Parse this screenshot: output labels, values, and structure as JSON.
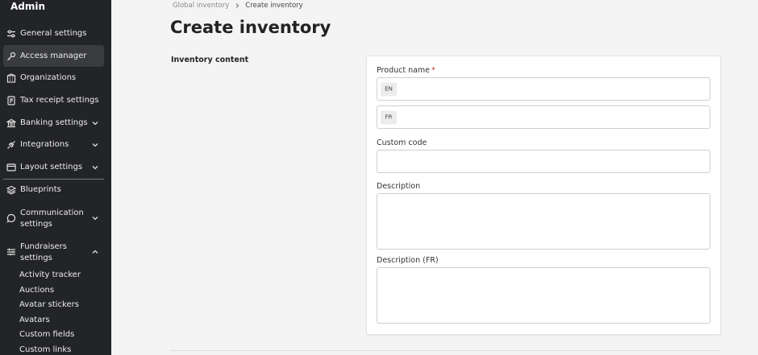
{
  "sidebar": {
    "title": "Admin",
    "items": [
      {
        "label": "General settings",
        "icon": "sliders-icon"
      },
      {
        "label": "Access manager",
        "icon": "key-icon"
      },
      {
        "label": "Organizations",
        "icon": "building-icon"
      },
      {
        "label": "Tax receipt settings",
        "icon": "receipt-icon"
      },
      {
        "label": "Banking settings",
        "icon": "bank-icon"
      },
      {
        "label": "Integrations",
        "icon": "plug-icon"
      },
      {
        "label": "Layout settings",
        "icon": "layout-icon"
      },
      {
        "label": "Blueprints",
        "icon": "layers-icon"
      },
      {
        "label_line1": "Communication",
        "label_line2": "settings",
        "icon": "chat-icon"
      },
      {
        "label_line1": "Fundraisers",
        "label_line2": "settings",
        "icon": "filters-icon"
      }
    ],
    "subitems": [
      "Activity tracker",
      "Auctions",
      "Avatar stickers",
      "Avatars",
      "Custom fields",
      "Custom links"
    ]
  },
  "breadcrumb": {
    "parent": "Global inventory",
    "current": "Create inventory"
  },
  "page": {
    "title": "Create inventory",
    "section": "Inventory content"
  },
  "form": {
    "product_name_label": "Product name",
    "required_mark": "*",
    "lang_en": "EN",
    "lang_fr": "FR",
    "custom_code_label": "Custom code",
    "description_label": "Description",
    "description_fr_label": "Description (FR)"
  },
  "colors": {
    "sidebar_bg": "#232427",
    "active_bg": "#3a3b3f",
    "page_bg": "#f4f4f4",
    "required": "#c0392b"
  }
}
